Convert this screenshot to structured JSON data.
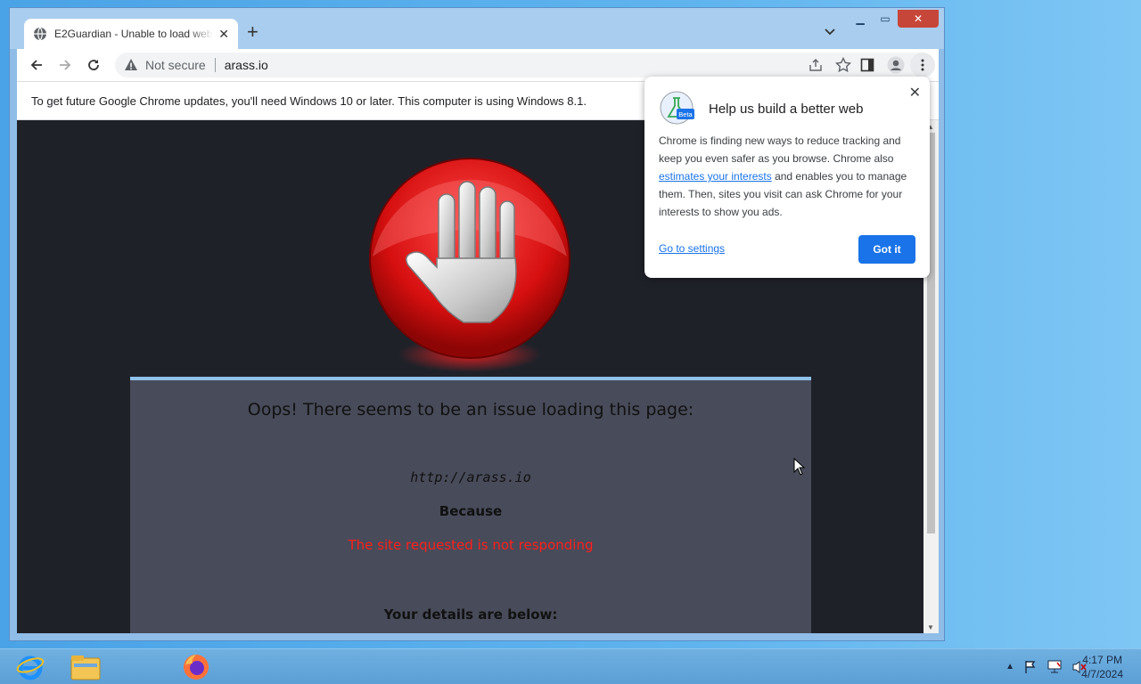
{
  "browser": {
    "tab_title": "E2Guardian - Unable to load web",
    "new_tab": "+",
    "omnibox": {
      "security_label": "Not secure",
      "url": "arass.io"
    },
    "infobar_text": "To get future Google Chrome updates, you'll need Windows 10 or later. This computer is using Windows 8.1."
  },
  "page": {
    "headline": "Oops! There seems to be an issue loading this page:",
    "blocked_url": "http://arass.io",
    "because_label": "Because",
    "reason": "The site requested is not responding",
    "details_label": "Your details are below:"
  },
  "popup": {
    "title": "Help us build a better web",
    "body_part1": "Chrome is finding new ways to reduce tracking and keep you even safer as you browse. Chrome also",
    "body_link": "estimates your interests",
    "body_part2": "and enables you to manage them. Then, sites you visit can ask Chrome for your interests to show you ads.",
    "go_settings": "Go to settings",
    "got_it": "Got it",
    "beta_badge": "Beta"
  },
  "taskbar": {
    "time": "4:17 PM",
    "date": "4/7/2024"
  },
  "colors": {
    "accent": "#1a73e8",
    "error_red": "#ff1e1e",
    "page_bg": "#1f2129",
    "card_bg": "#484b59"
  }
}
